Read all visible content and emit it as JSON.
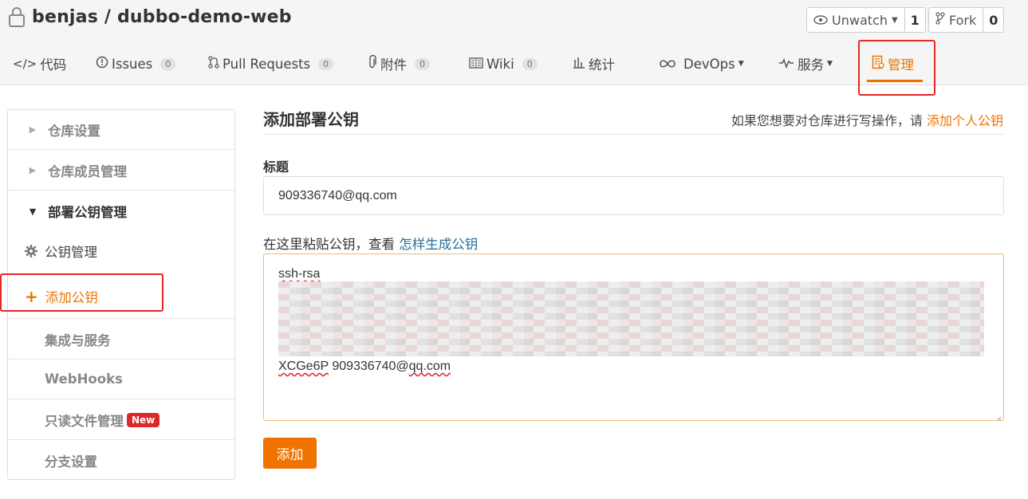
{
  "repo": {
    "title": "benjas / dubbo-demo-web"
  },
  "watch": {
    "label": "Unwatch",
    "count": "1"
  },
  "fork": {
    "label": "Fork",
    "count": "0"
  },
  "nav": {
    "code": "代码",
    "issues": "Issues",
    "issues_count": "0",
    "pulls": "Pull Requests",
    "pulls_count": "0",
    "attach": "附件",
    "attach_count": "0",
    "wiki": "Wiki",
    "wiki_count": "0",
    "stats": "统计",
    "devops": "DevOps",
    "service": "服务",
    "manage": "管理"
  },
  "sidebar": {
    "repo_settings": "仓库设置",
    "members": "仓库成员管理",
    "deploy_keys": "部署公钥管理",
    "key_manage": "公钥管理",
    "add_key": "添加公钥",
    "integrations": "集成与服务",
    "webhooks": "WebHooks",
    "readonly": "只读文件管理",
    "new_badge": "New",
    "branch": "分支设置"
  },
  "form": {
    "heading": "添加部署公钥",
    "hint_prefix": "如果您想要对仓库进行写操作，请",
    "hint_link": "添加个人公钥",
    "title_label": "标题",
    "title_value": "909336740@qq.com",
    "key_label_prefix": "在这里粘贴公钥，查看",
    "key_label_link": "怎样生成公钥",
    "key_line1": "ssh-rsa",
    "key_last_a": "XCGe6P",
    "key_last_b": "909336740@",
    "key_last_c": "qq.com",
    "submit": "添加"
  },
  "colors": {
    "accent": "#f07300",
    "highlight": "#e82626",
    "link": "#2a6e9b"
  }
}
